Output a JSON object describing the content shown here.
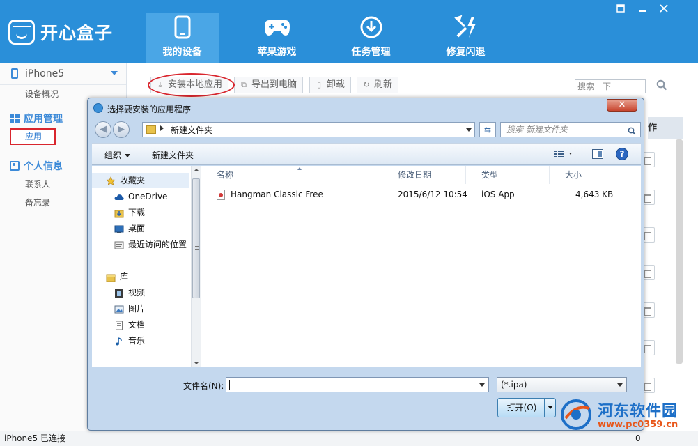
{
  "app": {
    "name": "开心盒子",
    "nav": [
      {
        "label": "我的设备",
        "icon": "phone-icon",
        "active": true
      },
      {
        "label": "苹果游戏",
        "icon": "gamepad-icon",
        "active": false
      },
      {
        "label": "任务管理",
        "icon": "download-icon",
        "active": false
      },
      {
        "label": "修复闪退",
        "icon": "repair-tools-icon",
        "active": false
      }
    ],
    "window_controls": [
      "menu",
      "minimize",
      "close"
    ]
  },
  "sidebar": {
    "device": "iPhone5",
    "device_overview": "设备概况",
    "app_group": "应用管理",
    "app_item": "应用",
    "personal_group": "个人信息",
    "contacts": "联系人",
    "memo": "备忘录"
  },
  "toolbar": {
    "install_local": "安装本地应用",
    "export_pc": "导出到电脑",
    "uninstall": "卸载",
    "refresh": "刷新",
    "search_placeholder": "搜索一下"
  },
  "table": {
    "header_partial": "作"
  },
  "status": {
    "left": "iPhone5 已连接",
    "right": "0"
  },
  "watermark": {
    "title": "河东软件园",
    "url": "www.pc0359.cn"
  },
  "dialog": {
    "title": "选择要安装的应用程序",
    "path": "新建文件夹",
    "search_placeholder": "搜索 新建文件夹",
    "organize": "组织",
    "new_folder": "新建文件夹",
    "nav": {
      "favorites": "收藏夹",
      "onedrive": "OneDrive",
      "downloads": "下载",
      "desktop": "桌面",
      "recent": "最近访问的位置",
      "libraries": "库",
      "videos": "视频",
      "pictures": "图片",
      "documents": "文档",
      "music": "音乐"
    },
    "columns": [
      "名称",
      "修改日期",
      "类型",
      "大小"
    ],
    "files": [
      {
        "name": "Hangman Classic Free",
        "modified": "2015/6/12 10:54",
        "type": "iOS App",
        "size": "4,643 KB"
      }
    ],
    "filename_label": "文件名(N):",
    "filename_value": "",
    "filter": "(*.ipa)",
    "open_button": "打开(O)"
  }
}
